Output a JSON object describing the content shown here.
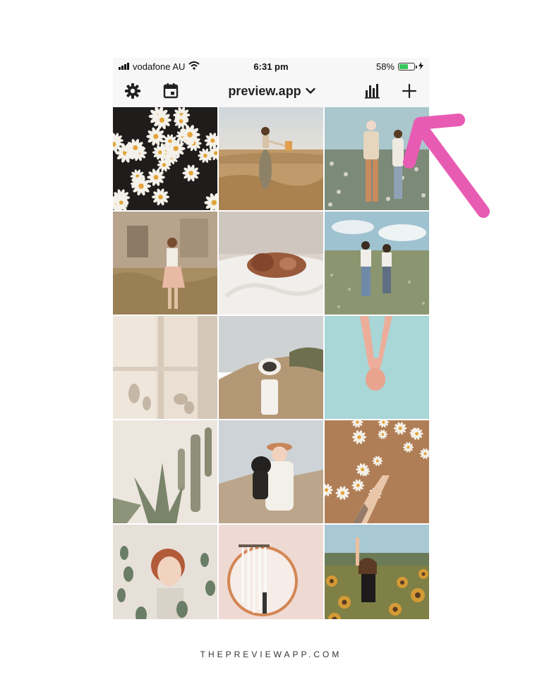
{
  "status_bar": {
    "carrier": "vodafone AU",
    "time": "6:31 pm",
    "battery_percent": "58%",
    "battery_level": 0.58,
    "icons": [
      "signal-icon",
      "wifi-icon",
      "battery-icon",
      "charging-icon"
    ]
  },
  "toolbar": {
    "title": "preview.app",
    "icons": [
      "gear-icon",
      "calendar-icon",
      "chevron-down-icon",
      "bar-chart-icon",
      "plus-icon"
    ]
  },
  "grid": {
    "tiles": [
      "daisies",
      "woman-in-field",
      "couple-in-flowers",
      "woman-by-house",
      "dog-in-bed",
      "couple-holding-hands",
      "curtain-shadows",
      "woman-with-hat",
      "hands-holding",
      "succulent-cactus",
      "woman-hugging-dog",
      "hand-with-daisies",
      "woman-with-eucalyptus",
      "mirror-with-macrame",
      "woman-in-sunflowers"
    ]
  },
  "annotation": {
    "color": "#e85bb3"
  },
  "colors": {
    "background": "#ffffff",
    "app_bg": "#f7f7f7",
    "battery": "#34c759"
  },
  "footer": {
    "text": "THEPREVIEWAPP.COM"
  }
}
